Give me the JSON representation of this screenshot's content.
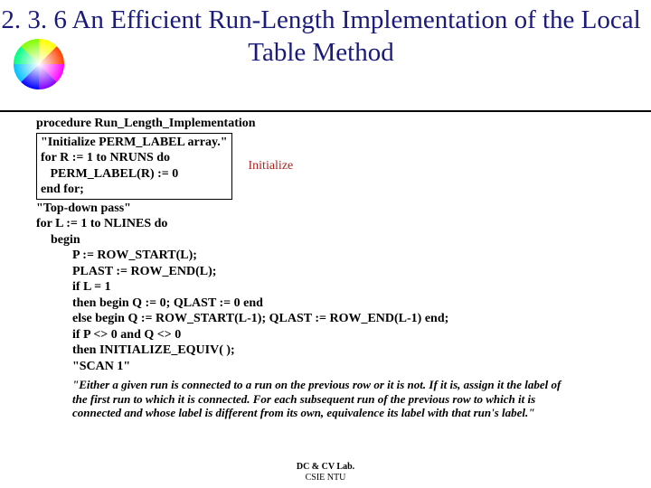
{
  "title": "2. 3. 6 An Efficient Run-Length Implementation of the Local Table Method",
  "code": {
    "proc": "procedure Run_Length_Implementation",
    "init_box": [
      "\"Initialize PERM_LABEL array.\"",
      "for R := 1 to NRUNS do",
      "   PERM_LABEL(R) := 0",
      "end for;"
    ],
    "init_label": "Initialize",
    "topdown": "\"Top-down pass\"",
    "forL": "for L := 1 to NLINES do",
    "begin": "begin",
    "body": [
      "P := ROW_START(L);",
      "PLAST := ROW_END(L);",
      "if L = 1",
      "then begin Q := 0; QLAST := 0 end",
      "else begin Q := ROW_START(L-1); QLAST := ROW_END(L-1) end;",
      "if P <> 0 and Q <> 0",
      "then INITIALIZE_EQUIV( );",
      "\"SCAN 1\""
    ],
    "comment": "\"Either a given run is connected to a run on the previous row or it is not. If it is, assign it the label of the first run to which it is connected. For each subsequent run of the previous row to which it is connected and whose label is different from its own, equivalence its label with that run's label.\""
  },
  "footer": {
    "l1": "DC & CV Lab.",
    "l2": "CSIE NTU"
  }
}
